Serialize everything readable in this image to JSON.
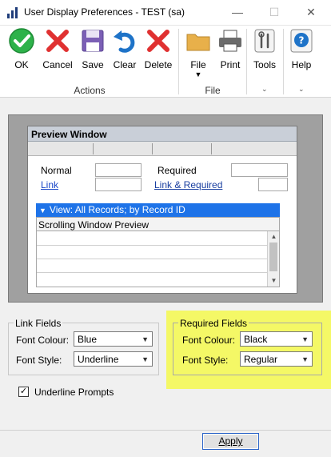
{
  "window": {
    "title": "User Display Preferences  -  TEST (sa)",
    "minimize_glyph": "—",
    "maximize_glyph": "☐",
    "close_glyph": "✕"
  },
  "ribbon": {
    "actions": [
      {
        "label": "OK",
        "icon": "check-circle-icon"
      },
      {
        "label": "Cancel",
        "icon": "red-x-icon"
      },
      {
        "label": "Save",
        "icon": "floppy-disk-icon"
      },
      {
        "label": "Clear",
        "icon": "undo-arrow-icon"
      },
      {
        "label": "Delete",
        "icon": "red-x-icon"
      }
    ],
    "actions_group_label": "Actions",
    "file_buttons": [
      {
        "label": "File",
        "icon": "folder-icon"
      },
      {
        "label": "Print",
        "icon": "printer-icon"
      }
    ],
    "file_group_label": "File",
    "tools": {
      "label": "Tools",
      "icon": "wrench-icon"
    },
    "help": {
      "label": "Help",
      "icon": "question-circle-icon"
    },
    "accent_color": "#1e73e8"
  },
  "preview": {
    "title": "Preview Window",
    "normal_label": "Normal",
    "link_label": "Link",
    "required_label": "Required",
    "link_required_label": "Link & Required",
    "bar_text": "View: All Records; by Record ID",
    "grid_header": "Scrolling Window Preview"
  },
  "link_fields": {
    "group_label": "Link Fields",
    "font_colour_label": "Font Colour:",
    "font_colour_value": "Blue",
    "font_style_label": "Font Style:",
    "font_style_value": "Underline"
  },
  "required_fields": {
    "group_label": "Required Fields",
    "font_colour_label": "Font Colour:",
    "font_colour_value": "Black",
    "font_style_label": "Font Style:",
    "font_style_value": "Regular",
    "highlight_color": "#f4f866"
  },
  "underline_prompts": {
    "label": "Underline Prompts",
    "checked": true,
    "check_glyph": "✓"
  },
  "apply_button": {
    "label": "Apply"
  }
}
